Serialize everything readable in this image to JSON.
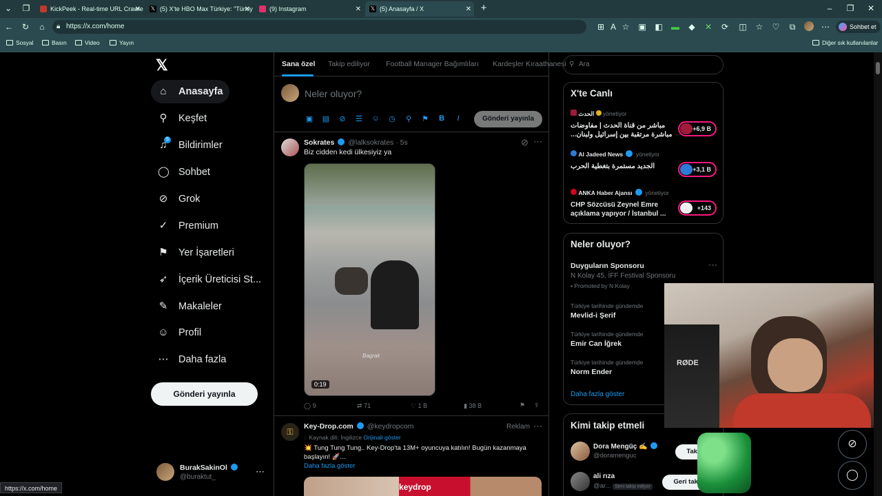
{
  "browser": {
    "tabs": [
      {
        "title": "KickPeek - Real-time URL Crawler",
        "color": "#c0392b",
        "active": false
      },
      {
        "title": "(5) X'te HBO Max Türkiye: \"Türkiye",
        "color": "#000000",
        "active": false
      },
      {
        "title": "(9) Instagram",
        "color": "#e1306c",
        "active": false
      },
      {
        "title": "(5) Anasayfa / X",
        "color": "#000000",
        "active": true
      }
    ],
    "url": "https://x.com/home",
    "profile_button": "Sohbet et",
    "bookmarks": [
      "Sosyal",
      "Basın",
      "Video",
      "Yayın"
    ],
    "other_bookmarks": "Diğer sık kullanılanlar",
    "status_url": "https://x.com/home"
  },
  "nav": {
    "items": [
      {
        "label": "Anasayfa",
        "icon": "home-icon",
        "glyph": "⌂",
        "active": true
      },
      {
        "label": "Keşfet",
        "icon": "search-icon",
        "glyph": "⚲",
        "active": false
      },
      {
        "label": "Bildirimler",
        "icon": "bell-icon",
        "glyph": "♫",
        "active": false
      },
      {
        "label": "Sohbet",
        "icon": "chat-icon",
        "glyph": "◯",
        "active": false
      },
      {
        "label": "Grok",
        "icon": "grok-icon",
        "glyph": "⊘",
        "active": false
      },
      {
        "label": "Premium",
        "icon": "premium-icon",
        "glyph": "✓",
        "active": false
      },
      {
        "label": "Yer İşaretleri",
        "icon": "bookmark-icon",
        "glyph": "⚑",
        "active": false
      },
      {
        "label": "İçerik Üreticisi St...",
        "icon": "rocket-icon",
        "glyph": "➶",
        "active": false
      },
      {
        "label": "Makaleler",
        "icon": "article-icon",
        "glyph": "✎",
        "active": false
      },
      {
        "label": "Profil",
        "icon": "profile-icon",
        "glyph": "☺",
        "active": false
      },
      {
        "label": "Daha fazla",
        "icon": "more-icon",
        "glyph": "⋯",
        "active": false
      }
    ],
    "notification_badge": "5",
    "post_button": "Gönderi yayınla",
    "account": {
      "name": "BurakSakinOl",
      "handle": "@buraktut_"
    }
  },
  "feed": {
    "tabs": [
      "Sana özel",
      "Takip ediliyor",
      "Football Manager Bağımlıları",
      "Kardeşler Kıraathanesi"
    ],
    "composer_placeholder": "Neler oluyor?",
    "composer_post": "Gönderi yayınla",
    "tweet1": {
      "name": "Sokrates",
      "handle": "@lalksokrates",
      "time": "· 5s",
      "text": "Biz cidden kedi ülkesiyiz ya",
      "video_duration": "0:19",
      "watermark": "Bagrak",
      "replies": "9",
      "reposts": "71",
      "likes": "1 B",
      "views": "38 B"
    },
    "tweet2": {
      "name": "Key-Drop.com",
      "handle": "@keydropcom",
      "ad_label": "Reklam",
      "source_lang": "Kaynak dili: İngilizce",
      "original": "Orijinali göster",
      "text": "💥 Tung Tung Tung.. Key-Drop'ta 13M+ oyuncuya katılın! Bugün kazanmaya başlayın! 🚀...",
      "show_more": "Daha fazla göster",
      "banner": "keydrop"
    }
  },
  "right": {
    "search_placeholder": "Ara",
    "live": {
      "title": "X'te Canlı",
      "items": [
        {
          "source": "الحدث",
          "status": "yönetiyor",
          "text": "مباشر من قناة الحدث | مفاوضات مباشرة مرتقبة بين إسرائيل ولبنان...",
          "count": "+6,9 B"
        },
        {
          "source": "Al Jadeed News",
          "status": "yönetiyor",
          "text": "الجديد مستمرة بتغطية الحرب",
          "count": "+3,1 B"
        },
        {
          "source": "ANKA Haber Ajansı",
          "status": "yönetiyor",
          "text": "CHP Sözcüsü Zeynel Emre açıklama yapıyor / İstanbul ...",
          "count": "+143"
        }
      ]
    },
    "trends": {
      "title": "Neler oluyor?",
      "sponsor_title": "Duyguların Sponsoru",
      "sponsor_sub": "N Kolay 45. İFF Festival Sponsoru",
      "promoted": "Promoted by N Kolay",
      "items": [
        {
          "context": "Türkiye tarihinde gündemde",
          "name": "Mevlid-i Şerif"
        },
        {
          "context": "Türkiye tarihinde gündemde",
          "name": "Emir Can İğrek"
        },
        {
          "context": "Türkiye tarihinde gündemde",
          "name": "Norm Ender"
        }
      ],
      "show_more": "Daha fazla göster"
    },
    "follow": {
      "title": "Kimi takip etmeli",
      "users": [
        {
          "name": "Dora Mengüç ✍",
          "handle": "@doramenguc",
          "button": "Takip et"
        },
        {
          "name": "ali rıza",
          "handle": "@ar...",
          "badge": "Seni takip ediyor",
          "button": "Geri takip et"
        }
      ]
    },
    "webcam_label": "RØDE"
  }
}
